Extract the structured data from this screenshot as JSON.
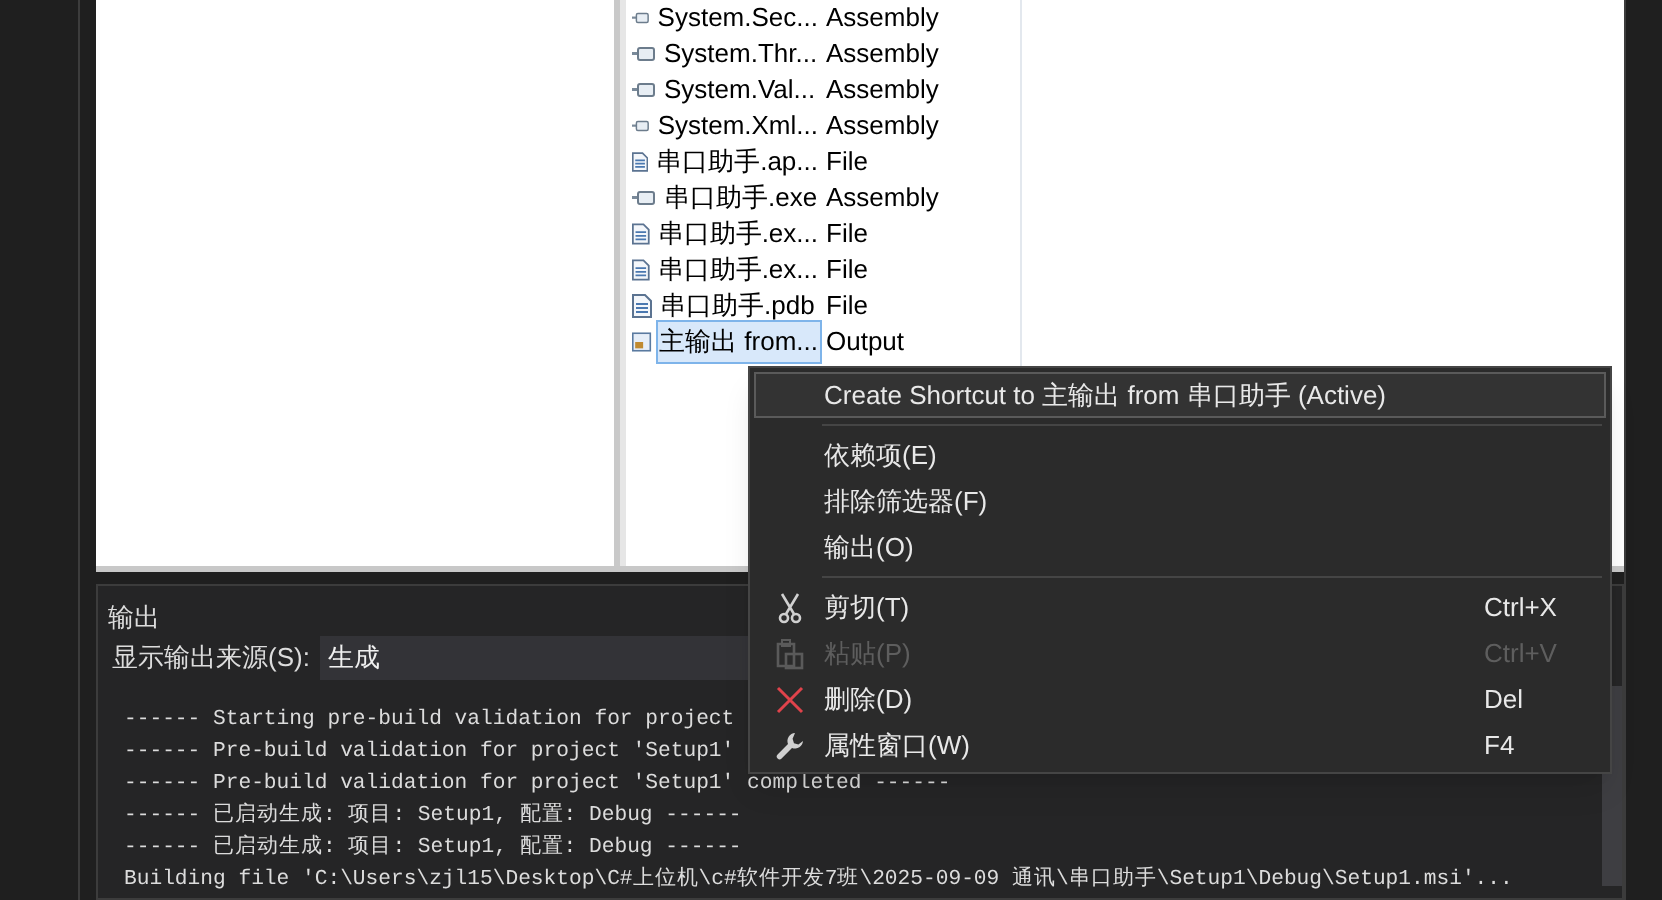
{
  "file_list": {
    "rows": [
      {
        "name": "System.Sec...",
        "type": "Assembly",
        "kind": "assembly",
        "selected": false
      },
      {
        "name": "System.Thr...",
        "type": "Assembly",
        "kind": "assembly",
        "selected": false
      },
      {
        "name": "System.Val...",
        "type": "Assembly",
        "kind": "assembly",
        "selected": false
      },
      {
        "name": "System.Xml...",
        "type": "Assembly",
        "kind": "assembly",
        "selected": false
      },
      {
        "name": "串口助手.ap...",
        "type": "File",
        "kind": "file",
        "selected": false
      },
      {
        "name": "串口助手.exe",
        "type": "Assembly",
        "kind": "assembly",
        "selected": false
      },
      {
        "name": "串口助手.ex...",
        "type": "File",
        "kind": "file",
        "selected": false
      },
      {
        "name": "串口助手.ex...",
        "type": "File",
        "kind": "file",
        "selected": false
      },
      {
        "name": "串口助手.pdb",
        "type": "File",
        "kind": "file",
        "selected": false
      },
      {
        "name": "主输出 from...",
        "type": "Output",
        "kind": "output",
        "selected": true
      }
    ]
  },
  "output_panel": {
    "title": "输出",
    "source_label": "显示输出来源(S):",
    "source_value": "生成",
    "lines": [
      "------ Starting pre-build validation for project",
      "------ Pre-build validation for project 'Setup1'",
      "------ Pre-build validation for project 'Setup1' completed ------",
      "------ 已启动生成: 项目: Setup1, 配置: Debug ------",
      "------ 已启动生成: 项目: Setup1, 配置: Debug ------",
      "Building file 'C:\\Users\\zjl15\\Desktop\\C#上位机\\c#软件开发7班\\2025-09-09 通讯\\串口助手\\Setup1\\Debug\\Setup1.msi'..."
    ]
  },
  "context_menu": {
    "items": [
      {
        "kind": "item",
        "label": "Create Shortcut to 主输出 from 串口助手 (Active)",
        "selected": true,
        "disabled": false
      },
      {
        "kind": "separator"
      },
      {
        "kind": "item",
        "label": "依赖项(E)",
        "selected": false,
        "disabled": false
      },
      {
        "kind": "item",
        "label": "排除筛选器(F)",
        "selected": false,
        "disabled": false
      },
      {
        "kind": "item",
        "label": "输出(O)",
        "selected": false,
        "disabled": false
      },
      {
        "kind": "separator"
      },
      {
        "kind": "cut",
        "label": "剪切(T)",
        "shortcut": "Ctrl+X",
        "selected": false,
        "disabled": false
      },
      {
        "kind": "paste",
        "label": "粘贴(P)",
        "shortcut": "Ctrl+V",
        "selected": false,
        "disabled": true
      },
      {
        "kind": "delete",
        "label": "删除(D)",
        "shortcut": "Del",
        "selected": false,
        "disabled": false
      },
      {
        "kind": "properties",
        "label": "属性窗口(W)",
        "shortcut": "F4",
        "selected": false,
        "disabled": false
      }
    ]
  }
}
